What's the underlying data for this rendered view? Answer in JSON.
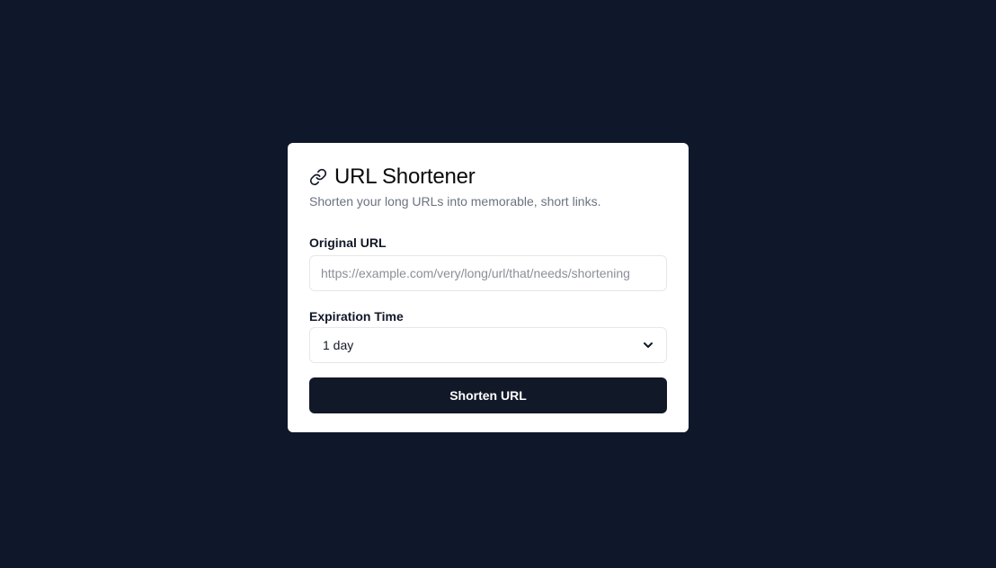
{
  "app": {
    "title": "URL Shortener",
    "subtitle": "Shorten your long URLs into memorable, short links.",
    "title_icon": "link-icon"
  },
  "form": {
    "original_url_label": "Original URL",
    "original_url_value": "",
    "original_url_placeholder": "https://example.com/very/long/url/that/needs/shortening",
    "expiration_label": "Expiration Time",
    "expiration_selected": "1 day",
    "expiration_icon": "chevron-down-icon",
    "submit_label": "Shorten URL"
  },
  "colors": {
    "page_background": "#0f172a",
    "card_background": "#ffffff",
    "button_background": "#111827",
    "button_text": "#ffffff",
    "subtitle_text": "#6b7280"
  }
}
